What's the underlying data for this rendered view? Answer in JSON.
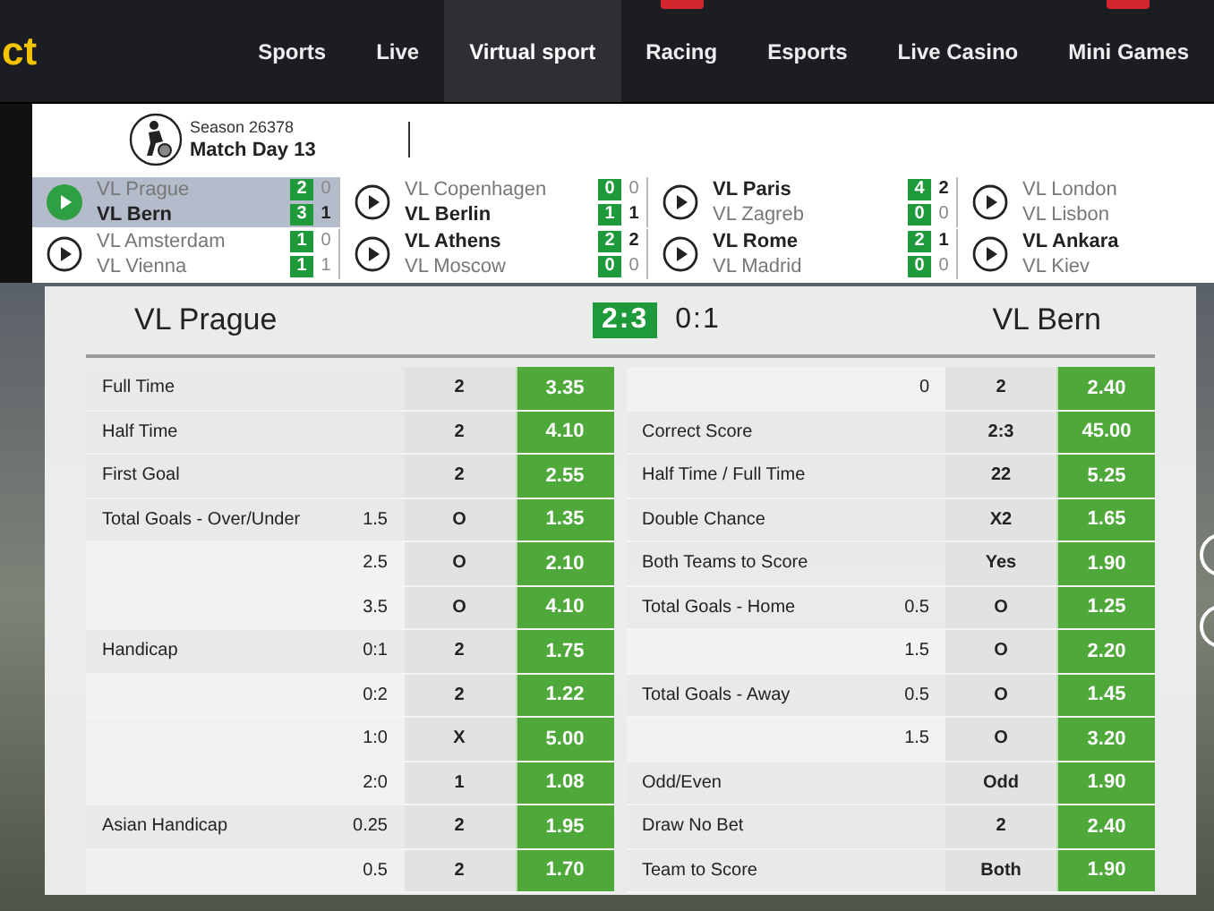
{
  "logo": "ct",
  "nav": [
    {
      "label": "Sports",
      "selected": false
    },
    {
      "label": "Live",
      "selected": false
    },
    {
      "label": "Virtual sport",
      "selected": true
    },
    {
      "label": "Racing",
      "selected": false,
      "has_badge": true
    },
    {
      "label": "Esports",
      "selected": false
    },
    {
      "label": "Live Casino",
      "selected": false
    },
    {
      "label": "Mini Games",
      "selected": false,
      "has_badge": true
    }
  ],
  "season": "Season 26378",
  "match_day": "Match Day 13",
  "matches": [
    {
      "selected": true,
      "teams": [
        {
          "name": "VL Prague",
          "leading": false,
          "score": "2",
          "half_time": "0"
        },
        {
          "name": "VL Bern",
          "leading": true,
          "score": "3",
          "half_time": "1"
        }
      ]
    },
    {
      "selected": false,
      "teams": [
        {
          "name": "VL Amsterdam",
          "leading": false,
          "score": "1",
          "half_time": "0"
        },
        {
          "name": "VL Vienna",
          "leading": false,
          "score": "1",
          "half_time": "1"
        }
      ]
    },
    {
      "selected": false,
      "teams": [
        {
          "name": "VL Copenhagen",
          "leading": false,
          "score": "0",
          "half_time": "0"
        },
        {
          "name": "VL Berlin",
          "leading": true,
          "score": "1",
          "half_time": "1"
        }
      ]
    },
    {
      "selected": false,
      "teams": [
        {
          "name": "VL Athens",
          "leading": true,
          "score": "2",
          "half_time": "2"
        },
        {
          "name": "VL Moscow",
          "leading": false,
          "score": "0",
          "half_time": "0"
        }
      ]
    },
    {
      "selected": false,
      "teams": [
        {
          "name": "VL Paris",
          "leading": true,
          "score": "4",
          "half_time": "2"
        },
        {
          "name": "VL Zagreb",
          "leading": false,
          "score": "0",
          "half_time": "0"
        }
      ]
    },
    {
      "selected": false,
      "teams": [
        {
          "name": "VL Rome",
          "leading": true,
          "score": "2",
          "half_time": "1"
        },
        {
          "name": "VL Madrid",
          "leading": false,
          "score": "0",
          "half_time": "0"
        }
      ]
    },
    {
      "selected": false,
      "teams": [
        {
          "name": "VL London",
          "leading": false
        },
        {
          "name": "VL Lisbon",
          "leading": false
        }
      ]
    },
    {
      "selected": false,
      "teams": [
        {
          "name": "VL Ankara",
          "leading": true
        },
        {
          "name": "VL Kiev",
          "leading": false
        }
      ]
    }
  ],
  "event": {
    "home": "VL Prague",
    "score": "2:3",
    "half_time": "0:1",
    "away": "VL Bern"
  },
  "left_rows": [
    {
      "market": "Full Time",
      "pick": "2",
      "odds": "3.35"
    },
    {
      "market": "Half Time",
      "pick": "2",
      "odds": "4.10"
    },
    {
      "market": "First Goal",
      "pick": "2",
      "odds": "2.55"
    },
    {
      "market": "Total Goals - Over/Under",
      "param": "1.5",
      "pick": "O",
      "odds": "1.35"
    },
    {
      "param": "2.5",
      "pick": "O",
      "odds": "2.10"
    },
    {
      "param": "3.5",
      "pick": "O",
      "odds": "4.10"
    },
    {
      "market": "Handicap",
      "param": "0:1",
      "pick": "2",
      "odds": "1.75"
    },
    {
      "param": "0:2",
      "pick": "2",
      "odds": "1.22"
    },
    {
      "param": "1:0",
      "pick": "X",
      "odds": "5.00"
    },
    {
      "param": "2:0",
      "pick": "1",
      "odds": "1.08"
    },
    {
      "market": "Asian Handicap",
      "param": "0.25",
      "pick": "2",
      "odds": "1.95"
    },
    {
      "param": "0.5",
      "pick": "2",
      "odds": "1.70"
    }
  ],
  "right_rows": [
    {
      "param": "0",
      "pick": "2",
      "odds": "2.40"
    },
    {
      "market": "Correct Score",
      "pick": "2:3",
      "odds": "45.00"
    },
    {
      "market": "Half Time / Full Time",
      "pick": "22",
      "odds": "5.25"
    },
    {
      "market": "Double Chance",
      "pick": "X2",
      "odds": "1.65"
    },
    {
      "market": "Both Teams to Score",
      "pick": "Yes",
      "odds": "1.90"
    },
    {
      "market": "Total Goals - Home",
      "param": "0.5",
      "pick": "O",
      "odds": "1.25"
    },
    {
      "param": "1.5",
      "pick": "O",
      "odds": "2.20"
    },
    {
      "market": "Total Goals - Away",
      "param": "0.5",
      "pick": "O",
      "odds": "1.45"
    },
    {
      "param": "1.5",
      "pick": "O",
      "odds": "3.20"
    },
    {
      "market": "Odd/Even",
      "pick": "Odd",
      "odds": "1.90"
    },
    {
      "market": "Draw No Bet",
      "pick": "2",
      "odds": "2.40"
    },
    {
      "market": "Team to Score",
      "pick": "Both",
      "odds": "1.90"
    }
  ]
}
